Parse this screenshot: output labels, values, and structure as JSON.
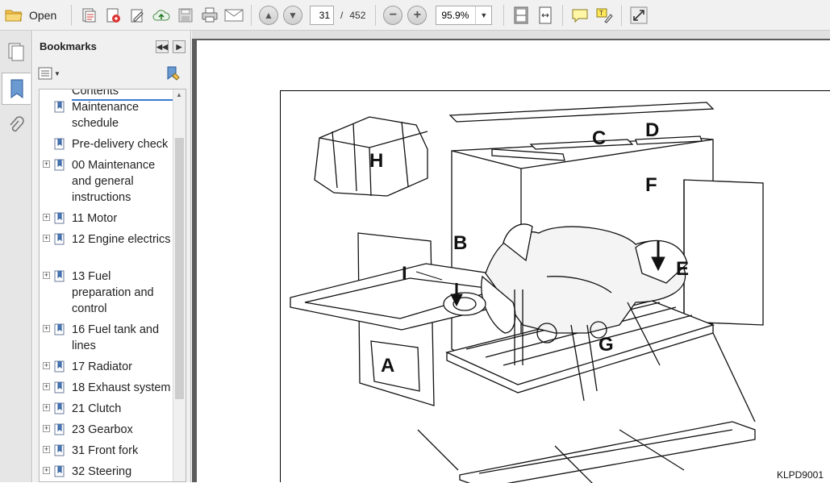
{
  "toolbar": {
    "open_label": "Open",
    "current_page": "31",
    "page_separator": "/",
    "total_pages": "452",
    "zoom": "95.9%"
  },
  "bookmarks_panel": {
    "title": "Bookmarks",
    "partial_item": "Contents",
    "items": [
      {
        "label": "Maintenance schedule",
        "expandable": false
      },
      {
        "label": "Pre-delivery check",
        "expandable": false
      },
      {
        "label": "00 Maintenance and general instructions",
        "expandable": true
      },
      {
        "label": "11 Motor",
        "expandable": true
      },
      {
        "label": "12 Engine electrics",
        "expandable": true
      },
      {
        "label": "13 Fuel preparation and control",
        "expandable": true
      },
      {
        "label": "16 Fuel tank and lines",
        "expandable": true
      },
      {
        "label": "17 Radiator",
        "expandable": true
      },
      {
        "label": "18 Exhaust system",
        "expandable": true
      },
      {
        "label": "21 Clutch",
        "expandable": true
      },
      {
        "label": "23 Gearbox",
        "expandable": true
      },
      {
        "label": "31 Front fork",
        "expandable": true
      },
      {
        "label": "32 Steering",
        "expandable": true
      }
    ]
  },
  "figure": {
    "labels": {
      "A": "A",
      "B": "B",
      "C": "C",
      "D": "D",
      "E": "E",
      "F": "F",
      "G": "G",
      "H": "H",
      "I": "I"
    },
    "code": "KLPD9001"
  },
  "icons": [
    "open-folder-icon",
    "create-pdf-icon",
    "print-icon",
    "edit-icon",
    "upload-icon",
    "save-icon",
    "printer-icon",
    "email-icon",
    "page-up-icon",
    "page-down-icon",
    "zoom-out-icon",
    "zoom-in-icon",
    "fit-page-icon",
    "fit-width-icon",
    "comment-icon",
    "highlight-icon",
    "expand-icon",
    "pages-icon",
    "bookmarks-icon",
    "attachments-icon"
  ]
}
